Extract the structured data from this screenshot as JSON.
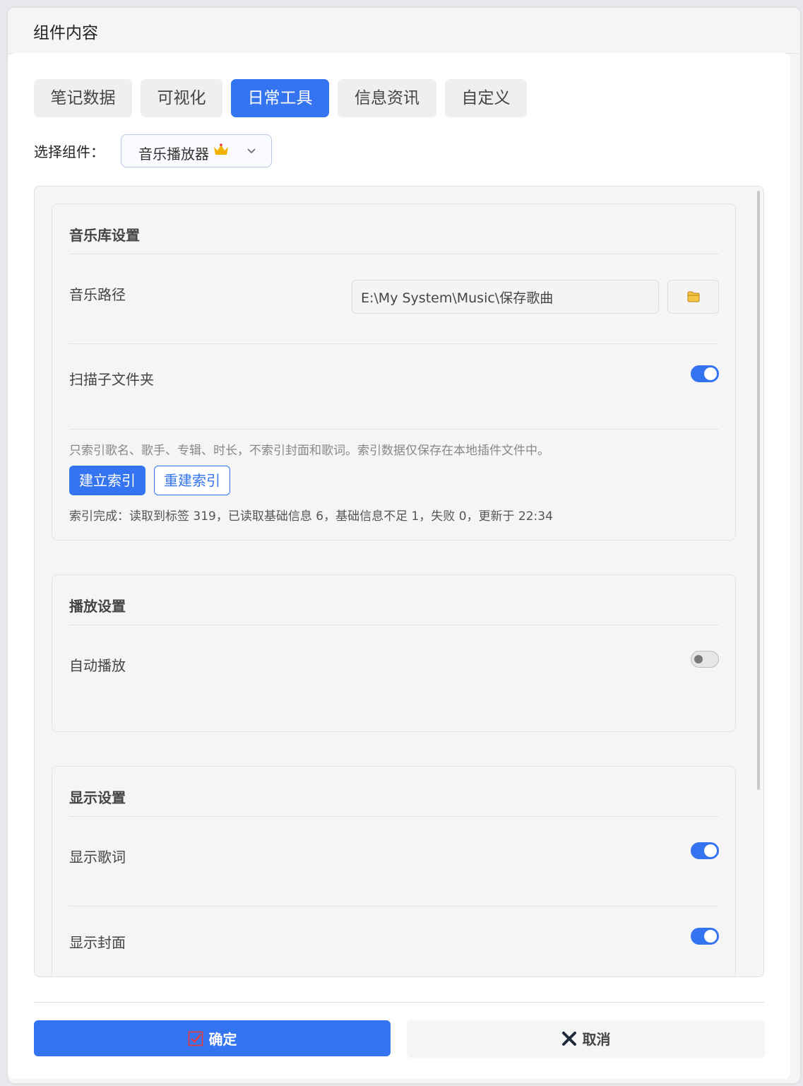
{
  "modal": {
    "title": "组件内容"
  },
  "tabs": [
    {
      "label": "笔记数据",
      "active": false
    },
    {
      "label": "可视化",
      "active": false
    },
    {
      "label": "日常工具",
      "active": true
    },
    {
      "label": "信息资讯",
      "active": false
    },
    {
      "label": "自定义",
      "active": false
    }
  ],
  "selector": {
    "label": "选择组件：",
    "value": "音乐播放器",
    "icon": "crown-icon"
  },
  "library": {
    "title": "音乐库设置",
    "path_label": "音乐路径",
    "path_value": "E:\\My System\\Music\\保存歌曲",
    "scan_label": "扫描子文件夹",
    "scan_on": true,
    "hint": "只索引歌名、歌手、专辑、时长，不索引封面和歌词。索引数据仅保存在本地插件文件中。",
    "build_label": "建立索引",
    "rebuild_label": "重建索引",
    "status": "索引完成：读取到标签 319，已读取基础信息 6，基础信息不足 1，失败 0，更新于 22:34"
  },
  "playback": {
    "title": "播放设置",
    "autoplay_label": "自动播放",
    "autoplay_on": false
  },
  "display": {
    "title": "显示设置",
    "lyrics_label": "显示歌词",
    "lyrics_on": true,
    "cover_label": "显示封面",
    "cover_on": true
  },
  "footer": {
    "ok_label": "确定",
    "cancel_label": "取消"
  },
  "colors": {
    "accent": "#3574f0",
    "folder": "#f0b400",
    "cancel_icon": "#1f2a3a"
  }
}
